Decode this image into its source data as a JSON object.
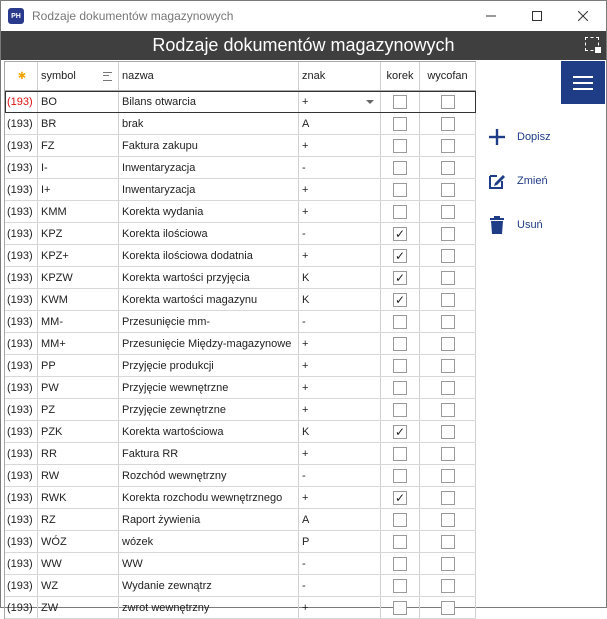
{
  "window": {
    "title": "Rodzaje dokumentów magazynowych",
    "app_icon": "PH"
  },
  "header": {
    "title": "Rodzaje dokumentów magazynowych"
  },
  "columns": {
    "marker": "",
    "symbol": "symbol",
    "nazwa": "nazwa",
    "znak": "znak",
    "korekta": "korek",
    "wycofany": "wycofan"
  },
  "actions": {
    "add": "Dopisz",
    "edit": "Zmień",
    "delete": "Usuń"
  },
  "colors": {
    "accent": "#1f3c87",
    "header_bg": "#3f3f3f",
    "marker_red": "#dd1111"
  },
  "rows": [
    {
      "marker": "(193)",
      "symbol": "BO",
      "nazwa": "Bilans otwarcia",
      "znak": "+",
      "korekta": false,
      "wycofany": false
    },
    {
      "marker": "(193)",
      "symbol": "BR",
      "nazwa": "brak",
      "znak": "A",
      "korekta": false,
      "wycofany": false
    },
    {
      "marker": "(193)",
      "symbol": "FZ",
      "nazwa": "Faktura zakupu",
      "znak": "+",
      "korekta": false,
      "wycofany": false
    },
    {
      "marker": "(193)",
      "symbol": "I-",
      "nazwa": "Inwentaryzacja",
      "znak": "-",
      "korekta": false,
      "wycofany": false
    },
    {
      "marker": "(193)",
      "symbol": "I+",
      "nazwa": "Inwentaryzacja",
      "znak": "+",
      "korekta": false,
      "wycofany": false
    },
    {
      "marker": "(193)",
      "symbol": "KMM",
      "nazwa": "Korekta wydania",
      "znak": "+",
      "korekta": false,
      "wycofany": false
    },
    {
      "marker": "(193)",
      "symbol": "KPZ",
      "nazwa": "Korekta ilościowa",
      "znak": "-",
      "korekta": true,
      "wycofany": false
    },
    {
      "marker": "(193)",
      "symbol": "KPZ+",
      "nazwa": "Korekta ilościowa dodatnia",
      "znak": "+",
      "korekta": true,
      "wycofany": false
    },
    {
      "marker": "(193)",
      "symbol": "KPZW",
      "nazwa": "Korekta wartości przyjęcia",
      "znak": "K",
      "korekta": true,
      "wycofany": false
    },
    {
      "marker": "(193)",
      "symbol": "KWM",
      "nazwa": "Korekta wartości magazynu",
      "znak": "K",
      "korekta": true,
      "wycofany": false
    },
    {
      "marker": "(193)",
      "symbol": "MM-",
      "nazwa": "Przesunięcie mm-",
      "znak": "-",
      "korekta": false,
      "wycofany": false
    },
    {
      "marker": "(193)",
      "symbol": "MM+",
      "nazwa": "Przesunięcie Między-magazynowe",
      "znak": "+",
      "korekta": false,
      "wycofany": false
    },
    {
      "marker": "(193)",
      "symbol": "PP",
      "nazwa": "Przyjęcie produkcji",
      "znak": "+",
      "korekta": false,
      "wycofany": false
    },
    {
      "marker": "(193)",
      "symbol": "PW",
      "nazwa": "Przyjęcie wewnętrzne",
      "znak": "+",
      "korekta": false,
      "wycofany": false
    },
    {
      "marker": "(193)",
      "symbol": "PZ",
      "nazwa": "Przyjęcie zewnętrzne",
      "znak": "+",
      "korekta": false,
      "wycofany": false
    },
    {
      "marker": "(193)",
      "symbol": "PZK",
      "nazwa": "Korekta wartościowa",
      "znak": "K",
      "korekta": true,
      "wycofany": false
    },
    {
      "marker": "(193)",
      "symbol": "RR",
      "nazwa": "Faktura RR",
      "znak": "+",
      "korekta": false,
      "wycofany": false
    },
    {
      "marker": "(193)",
      "symbol": "RW",
      "nazwa": "Rozchód wewnętrzny",
      "znak": "-",
      "korekta": false,
      "wycofany": false
    },
    {
      "marker": "(193)",
      "symbol": "RWK",
      "nazwa": "Korekta rozchodu wewnętrznego",
      "znak": "+",
      "korekta": true,
      "wycofany": false
    },
    {
      "marker": "(193)",
      "symbol": "RZ",
      "nazwa": "Raport żywienia",
      "znak": "A",
      "korekta": false,
      "wycofany": false
    },
    {
      "marker": "(193)",
      "symbol": "WÓZ",
      "nazwa": "wózek",
      "znak": "P",
      "korekta": false,
      "wycofany": false
    },
    {
      "marker": "(193)",
      "symbol": "WW",
      "nazwa": "WW",
      "znak": "-",
      "korekta": false,
      "wycofany": false
    },
    {
      "marker": "(193)",
      "symbol": "WZ",
      "nazwa": "Wydanie zewnątrz",
      "znak": "-",
      "korekta": false,
      "wycofany": false
    },
    {
      "marker": "(193)",
      "symbol": "ZW",
      "nazwa": "zwrot wewnętrzny",
      "znak": "+",
      "korekta": false,
      "wycofany": false
    }
  ]
}
